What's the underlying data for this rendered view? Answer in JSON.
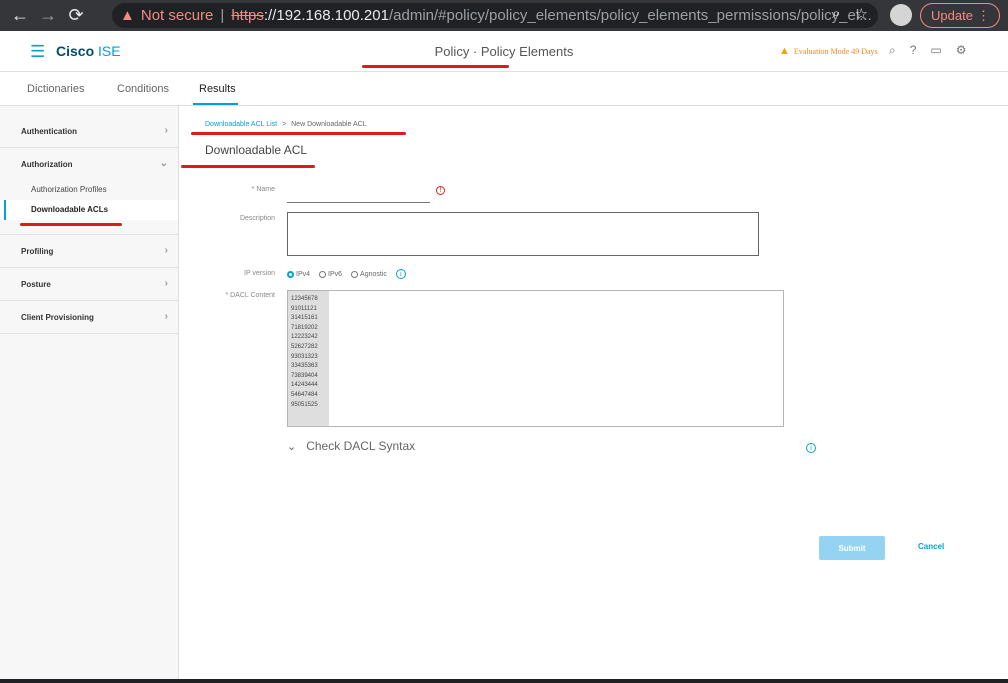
{
  "browser": {
    "warning": "Not secure",
    "scheme": "https",
    "host": "://192.168.100.201",
    "path": "/admin/#policy/policy_elements/policy_elements_permissions/policy_el...",
    "update_label": "Update"
  },
  "header": {
    "brand_bold": "Cisco",
    "brand_rest": " ISE",
    "page_title": "Policy · Policy Elements",
    "evaluation": "Evaluation Mode 49 Days"
  },
  "tabs": [
    {
      "label": "Dictionaries"
    },
    {
      "label": "Conditions"
    },
    {
      "label": "Results"
    }
  ],
  "sidebar": {
    "authentication": "Authentication",
    "authorization": "Authorization",
    "authorization_profiles": "Authorization Profiles",
    "downloadable_acls": "Downloadable ACLs",
    "profiling": "Profiling",
    "posture": "Posture",
    "client_provisioning": "Client Provisioning"
  },
  "breadcrumb": {
    "link": "Downloadable ACL List",
    "separator": ">",
    "current": "New Downloadable ACL"
  },
  "form": {
    "heading": "Downloadable ACL",
    "name_label": "* Name",
    "description_label": "Description",
    "ip_version_label": "IP version",
    "ip_options": [
      "IPv4",
      "IPv6",
      "Agnostic"
    ],
    "dacl_label": "* DACL Content",
    "line_numbers": [
      "12345678",
      "91011121",
      "31415161",
      "71819202",
      "12223242",
      "52627282",
      "93031323",
      "33435363",
      "73839404",
      "14243444",
      "54647484",
      "95051525"
    ],
    "check_syntax": "Check DACL Syntax",
    "submit": "Submit",
    "cancel": "Cancel"
  }
}
